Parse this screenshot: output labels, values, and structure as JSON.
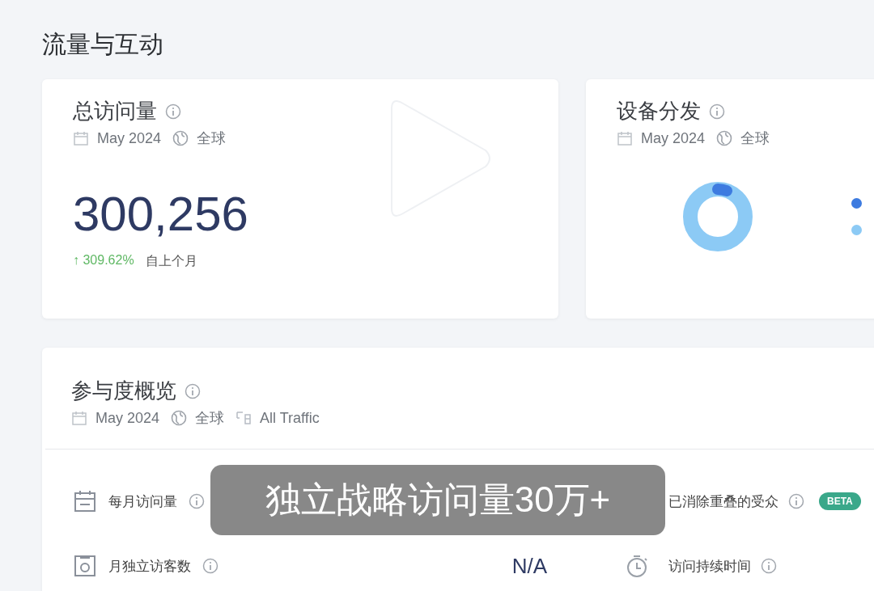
{
  "page_title": "流量与互动",
  "total_visits": {
    "title": "总访问量",
    "date": "May 2024",
    "region": "全球",
    "value": "300,256",
    "change": "↑ 309.62%",
    "change_note": "自上个月"
  },
  "device_distribution": {
    "title": "设备分发",
    "date": "May 2024",
    "region": "全球",
    "legend": [
      {
        "color": "#3d7be0"
      },
      {
        "color": "#8ccaf5"
      }
    ]
  },
  "engagement": {
    "title": "参与度概览",
    "date": "May 2024",
    "region": "全球",
    "traffic": "All Traffic",
    "rows": [
      {
        "left_label": "每月访问量",
        "right_label": "已消除重叠的受众",
        "right_badge": "BETA"
      },
      {
        "left_label": "月独立访客数",
        "left_value": "N/A",
        "right_label": "访问持续时间"
      }
    ]
  },
  "video_overlay": {
    "caption": "独立战略访问量30万+"
  }
}
